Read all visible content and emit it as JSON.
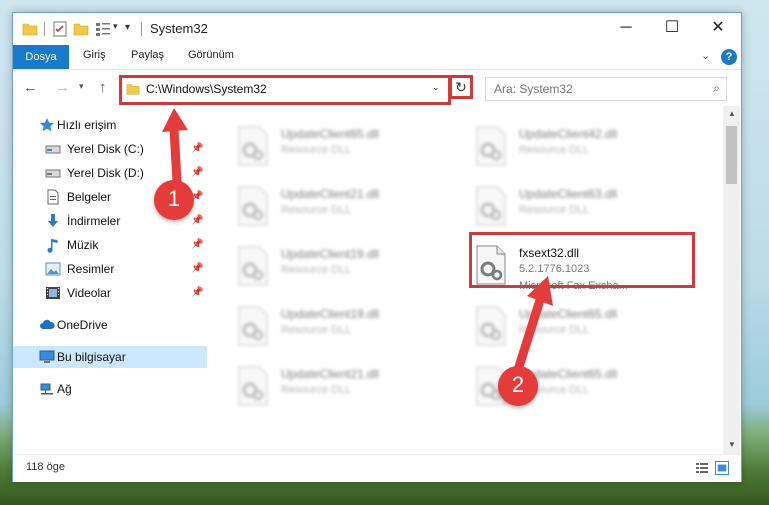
{
  "window": {
    "title": "System32",
    "controls": {
      "minimize": "─",
      "maximize": "☐",
      "close": "✕"
    }
  },
  "ribbon": {
    "tabs": {
      "file": "Dosya",
      "home": "Giriş",
      "share": "Paylaş",
      "view": "Görünüm"
    },
    "help": "?"
  },
  "navigation": {
    "address": "C:\\Windows\\System32",
    "search_placeholder": "Ara: System32"
  },
  "sidebar": {
    "quick_access": "Hızlı erişim",
    "pinned": [
      {
        "label": "Yerel Disk (C:)",
        "icon": "drive-icon"
      },
      {
        "label": "Yerel Disk (D:)",
        "icon": "drive-icon"
      },
      {
        "label": "Belgeler",
        "icon": "documents-icon"
      },
      {
        "label": "İndirmeler",
        "icon": "downloads-icon"
      },
      {
        "label": "Müzik",
        "icon": "music-icon"
      },
      {
        "label": "Resimler",
        "icon": "pictures-icon"
      },
      {
        "label": "Videolar",
        "icon": "videos-icon"
      }
    ],
    "onedrive": "OneDrive",
    "this_pc": "Bu bilgisayar",
    "network": "Ağ"
  },
  "files": [
    {
      "name": "UpdateClient65.dll",
      "desc": "Resource DLL"
    },
    {
      "name": "UpdateClient42.dll",
      "desc": "Resource DLL"
    },
    {
      "name": "UpdateClient21.dll",
      "desc": "Resource DLL"
    },
    {
      "name": "UpdateClient63.dll",
      "desc": "Resource DLL"
    },
    {
      "name": "UpdateClient19.dll",
      "desc": "Resource DLL"
    },
    {
      "name": "fxsext32.dll",
      "version": "5.2.1776.1023",
      "desc": "Microsoft Fax Excha..."
    },
    {
      "name": "UpdateClient19.dll",
      "desc": "Resource DLL"
    },
    {
      "name": "UpdateClient65.dll",
      "desc": "Resource DLL"
    },
    {
      "name": "UpdateClient21.dll",
      "desc": "Resource DLL"
    },
    {
      "name": "UpdateClient65.dll",
      "desc": "Resource DLL"
    }
  ],
  "status": {
    "item_count": "118 öge"
  },
  "annotations": {
    "step1": "1",
    "step2": "2",
    "color": "#e53b3b"
  }
}
